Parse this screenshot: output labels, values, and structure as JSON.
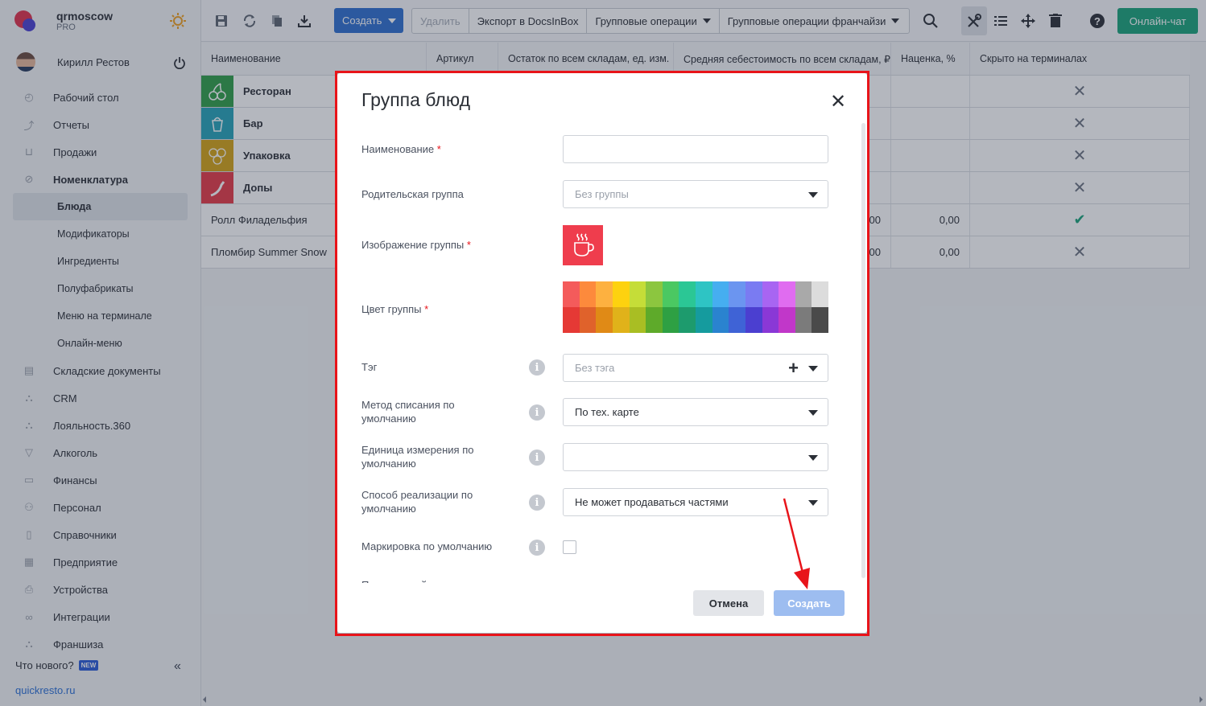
{
  "brand": {
    "name": "qrmoscow",
    "plan": "PRO"
  },
  "user": {
    "name": "Кирилл Рестов"
  },
  "sidebar": {
    "items": [
      {
        "label": "Рабочий стол",
        "icon": "dashboard-icon"
      },
      {
        "label": "Отчеты",
        "icon": "chart-icon"
      },
      {
        "label": "Продажи",
        "icon": "basket-icon"
      },
      {
        "label": "Номенклатура",
        "icon": "tag-icon"
      },
      {
        "label": "Складские документы",
        "icon": "box-icon"
      },
      {
        "label": "CRM",
        "icon": "crm-icon"
      },
      {
        "label": "Лояльность.360",
        "icon": "loyalty-icon"
      },
      {
        "label": "Алкоголь",
        "icon": "glass-icon"
      },
      {
        "label": "Финансы",
        "icon": "wallet-icon"
      },
      {
        "label": "Персонал",
        "icon": "people-icon"
      },
      {
        "label": "Справочники",
        "icon": "book-icon"
      },
      {
        "label": "Предприятие",
        "icon": "building-icon"
      },
      {
        "label": "Устройства",
        "icon": "printer-icon"
      },
      {
        "label": "Интеграции",
        "icon": "link-icon"
      },
      {
        "label": "Франшиза",
        "icon": "franchise-icon"
      }
    ],
    "sub_items": [
      "Блюда",
      "Модификаторы",
      "Ингредиенты",
      "Полуфабрикаты",
      "Меню на терминале",
      "Онлайн-меню"
    ],
    "whats_new": "Что нового?",
    "new_badge": "NEW",
    "site": "quickresto.ru"
  },
  "toolbar": {
    "create": "Создать",
    "delete": "Удалить",
    "export": "Экспорт в DocsInBox",
    "group_ops": "Групповые операции",
    "group_ops_franchise": "Групповые операции франчайзи",
    "chat": "Онлайн-чат"
  },
  "table": {
    "columns": [
      "Наименование",
      "Артикул",
      "Остаток по всем складам, ед. изм.",
      "Средняя себестоимость по всем складам, ₽",
      "Наценка, %",
      "Скрыто на терминалах"
    ],
    "groups": [
      {
        "name": "Ресторан",
        "color": "#2e9e48",
        "icon": "cherry-icon"
      },
      {
        "name": "Бар",
        "color": "#25a3b8",
        "icon": "cocktail-icon"
      },
      {
        "name": "Упаковка",
        "color": "#d4a315",
        "icon": "honeycomb-icon"
      },
      {
        "name": "Допы",
        "color": "#e63946",
        "icon": "pepper-icon"
      }
    ],
    "items": [
      {
        "name": "Ролл Филадельфия",
        "cost_tail": "00",
        "markup": "0,00",
        "hidden": "check"
      },
      {
        "name": "Пломбир Summer Snow",
        "cost_tail": "00",
        "markup": "0,00",
        "hidden": "cross"
      }
    ]
  },
  "modal": {
    "title": "Группа блюд",
    "fields": {
      "name": {
        "label": "Наименование",
        "value": ""
      },
      "parent": {
        "label": "Родительская группа",
        "placeholder": "Без группы"
      },
      "image": {
        "label": "Изображение группы",
        "icon": "hot-cup-icon",
        "color": "#ef3d4d"
      },
      "color": {
        "label": "Цвет группы"
      },
      "tag": {
        "label": "Тэг",
        "placeholder": "Без тэга"
      },
      "writeoff": {
        "label": "Метод списания по умолчанию",
        "value": "По тех. карте"
      },
      "unit": {
        "label": "Единица измерения по умолчанию",
        "value": ""
      },
      "sale": {
        "label": "Способ реализации по умолчанию",
        "value": "Не может продаваться частями"
      },
      "marking": {
        "label": "Маркировка по умолчанию"
      },
      "cut": {
        "label": "Подакцизный товар по умолчанию"
      }
    },
    "palette_top": [
      "#f45b5b",
      "#fd8a3c",
      "#fdb140",
      "#fdd20f",
      "#c5dd38",
      "#8cc63f",
      "#4bc862",
      "#2bc795",
      "#2ec4c4",
      "#46aef0",
      "#6b95f0",
      "#7a7bf2",
      "#a865f2",
      "#e06cf0",
      "#a9a9a9",
      "#dcdcdc"
    ],
    "palette_bottom": [
      "#e53935",
      "#e0622b",
      "#e08a16",
      "#e0b21a",
      "#a9be23",
      "#5eaa2a",
      "#2ea043",
      "#1d9b6d",
      "#159b9e",
      "#2a83cf",
      "#3f63d6",
      "#4b3fd0",
      "#8a38d6",
      "#c137c9",
      "#7b7b7b",
      "#4a4a4a"
    ],
    "cancel": "Отмена",
    "submit": "Создать"
  }
}
